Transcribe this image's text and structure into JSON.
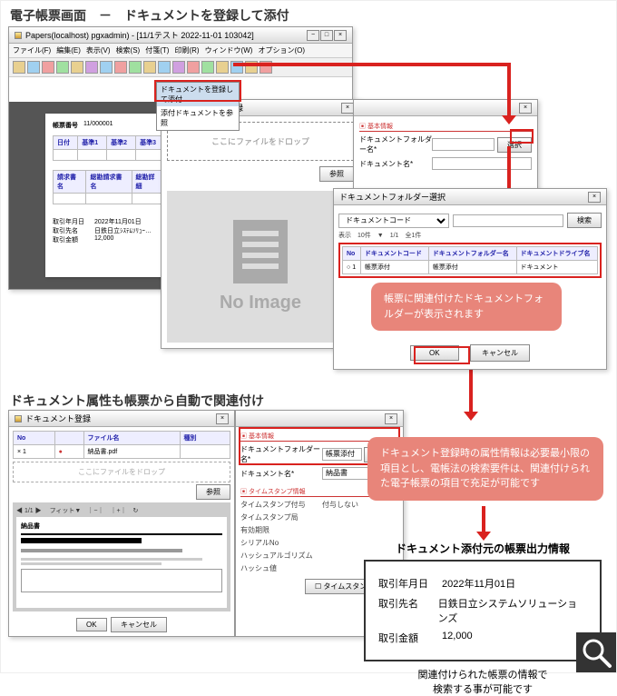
{
  "titles": {
    "section1": "電子帳票画面　－　ドキュメントを登録して添付",
    "section2": "ドキュメント属性も帳票から自動で関連付け"
  },
  "win1": {
    "title": "Papers(localhost) pgxadmin) - [11/1テスト 2022-11-01 103042]",
    "menu": [
      "ファイル(F)",
      "編集(E)",
      "表示(V)",
      "検索(S)",
      "付箋(T)",
      "印刷(R)",
      "ウィンドウ(W)",
      "オプション(O)"
    ],
    "ctx1": "ドキュメントを登録して添付",
    "ctx2": "添付ドキュメントを参照"
  },
  "form1": {
    "h1": "帳票番号",
    "v1": "11/000001",
    "cols": [
      "日付",
      "基準1",
      "基準2",
      "基準3"
    ],
    "h2": "請求書名",
    "h3": "総勘請求書名",
    "h4": "総勘詳細",
    "r1k": "取引年月日",
    "r1v": "2022年11月01日",
    "r2k": "取引先名",
    "r2v": "日鉄日立ｼｽﾃﾑｿﾘｭｰ…",
    "r3k": "取引金額",
    "r3v": "12,000"
  },
  "win2": {
    "title": "ドキュメント登録",
    "group": "基本情報",
    "f1": "ドキュメントフォルダー名*",
    "f2": "ドキュメント名*",
    "btn_sel": "選択",
    "drop": "ここにファイルをドロップ",
    "btn_ref": "参照",
    "noimg": "No Image"
  },
  "win3": {
    "title": "ドキュメントフォルダー選択",
    "combo_lbl": "ドキュメントコード",
    "btn_search": "検索",
    "pager": "表示　10件　▼　1/1　全1件",
    "th": [
      "No",
      "ドキュメントコード",
      "ドキュメントフォルダー名",
      "ドキュメントドライブ名"
    ],
    "td": [
      "1",
      "帳票添付",
      "帳票添付",
      "ドキュメント"
    ],
    "ok": "OK",
    "cancel": "キャンセル"
  },
  "callout1": "帳票に関連付けたドキュメントフォルダーが表示されます",
  "win4": {
    "title": "ドキュメント登録",
    "th": [
      "No",
      "",
      "ファイル名",
      "種別"
    ],
    "td": [
      "1",
      "",
      "納品書.pdf",
      ""
    ],
    "drop": "ここにファイルをドロップ",
    "btn_ref": "参照",
    "preview": "納品書",
    "ok": "OK",
    "cancel": "キャンセル"
  },
  "win5": {
    "group1": "基本情報",
    "f1l": "ドキュメントフォルダー名*",
    "f1v": "帳票添付",
    "f2l": "ドキュメント名*",
    "f2v": "納品書",
    "btn_sel": "選択",
    "group2": "タイムスタンプ情報",
    "tl1": "タイムスタンプ付与",
    "tr1": "付与しない",
    "tl2": "タイムスタンプ局",
    "tl3": "有効期限",
    "tl4": "シリアルNo",
    "tl5": "ハッシュアルゴリズム",
    "tl6": "ハッシュ値",
    "tbtn": "タイムスタンプ一覧"
  },
  "callout2": "ドキュメント登録時の属性情報は必要最小限の項目とし、電帳法の検索要件は、関連付けられた電子帳票の項目で充足が可能です",
  "out": {
    "title": "ドキュメント添付元の帳票出力情報",
    "r1k": "取引年月日",
    "r1v": "2022年11月01日",
    "r2k": "取引先名",
    "r2v": "日鉄日立システムソリューションズ",
    "r3k": "取引金額",
    "r3v": "12,000",
    "note": "関連付けられた帳票の情報で\n検索する事が可能です"
  }
}
